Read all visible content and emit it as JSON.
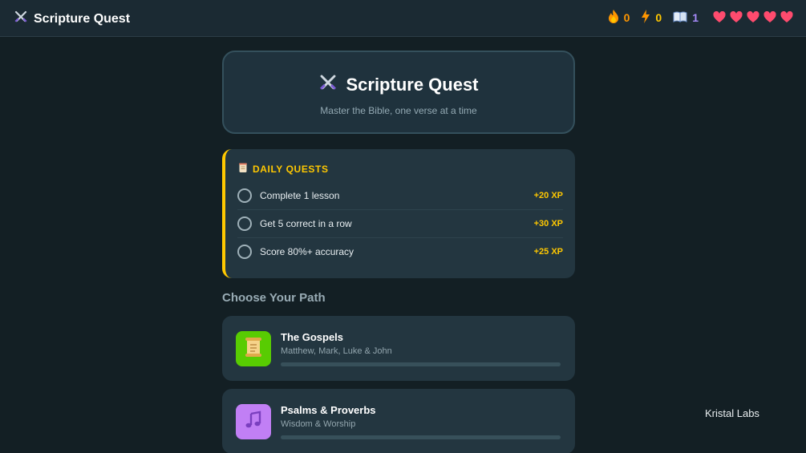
{
  "app": {
    "title": "Scripture Quest",
    "logo_icon": "crossed-swords-icon"
  },
  "stats": {
    "streak": {
      "icon": "fire-icon",
      "value": "0",
      "color": "#ff9600"
    },
    "xp": {
      "icon": "lightning-bolt-icon",
      "value": "0",
      "color": "#ffc800"
    },
    "lessons": {
      "icon": "open-book-icon",
      "value": "1",
      "color": "#a78bfa"
    },
    "hearts": {
      "icon": "heart-icon",
      "count": 5,
      "color": "#ff4b4b"
    }
  },
  "hero": {
    "title": "Scripture Quest",
    "subtitle": "Master the Bible, one verse at a time"
  },
  "daily_quests": {
    "heading": "DAILY QUESTS",
    "icon": "scroll-icon",
    "items": [
      {
        "label": "Complete 1 lesson",
        "xp": "+20 XP",
        "done": false
      },
      {
        "label": "Get 5 correct in a row",
        "xp": "+30 XP",
        "done": false
      },
      {
        "label": "Score 80%+ accuracy",
        "xp": "+25 XP",
        "done": false
      }
    ]
  },
  "paths": {
    "heading": "Choose Your Path",
    "items": [
      {
        "title": "The Gospels",
        "subtitle": "Matthew, Mark, Luke & John",
        "icon": "scroll-icon",
        "color": "#58cc02",
        "progress": 0
      },
      {
        "title": "Psalms & Proverbs",
        "subtitle": "Wisdom & Worship",
        "icon": "music-note-icon",
        "color": "#c17ff5",
        "progress": 0
      }
    ]
  },
  "watermark": "Kristal Labs",
  "colors": {
    "background": "#131f24",
    "accent": "#ffc800",
    "card": "#233640"
  }
}
